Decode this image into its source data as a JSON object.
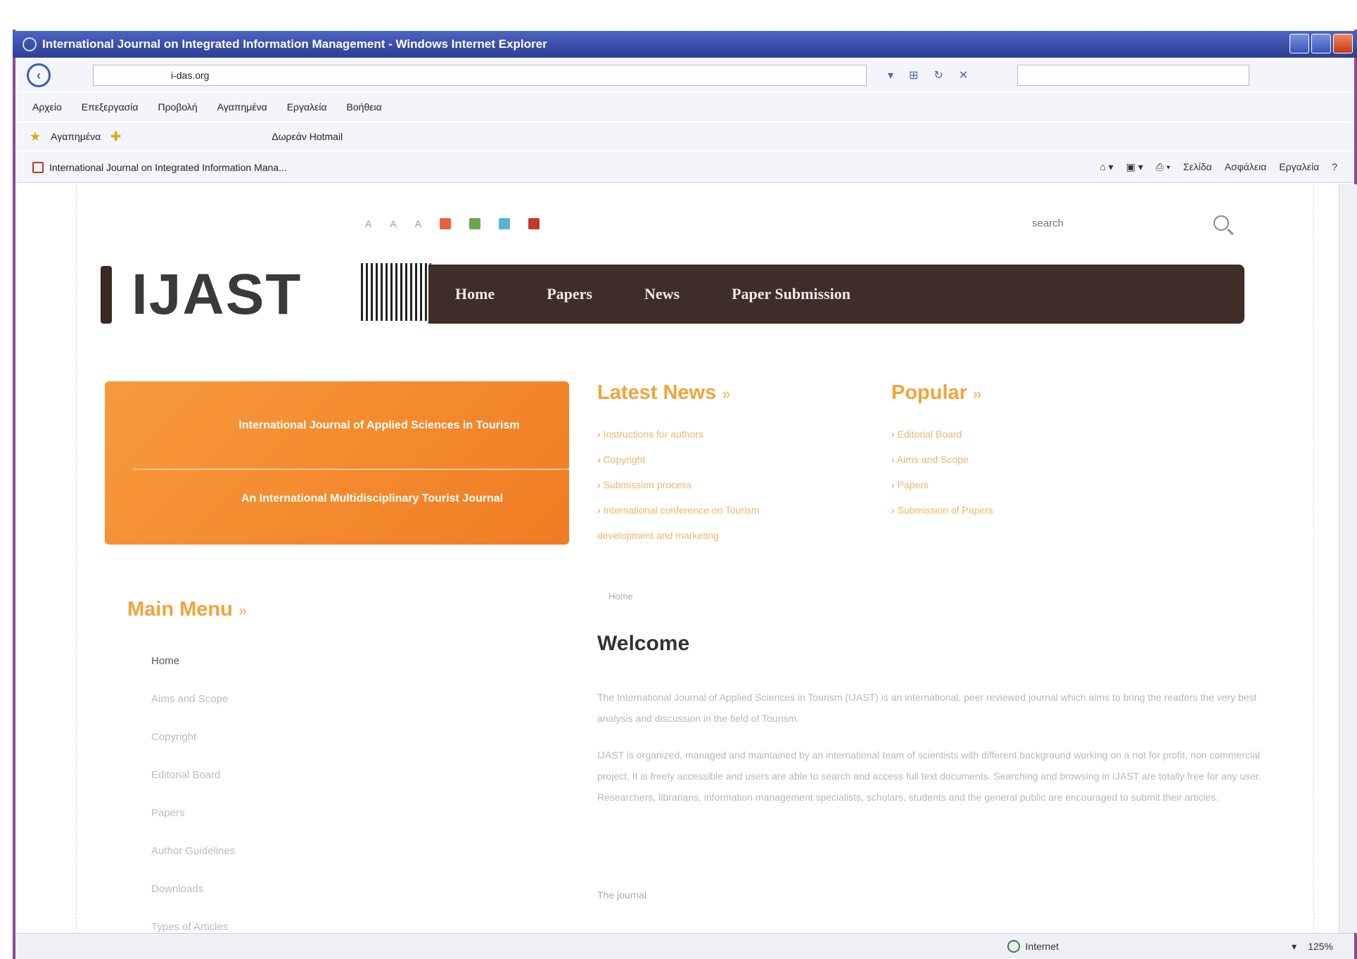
{
  "window": {
    "title": "International Journal on Integrated Information Management - Windows Internet Explorer"
  },
  "browser": {
    "address": "i-das.org",
    "menu": [
      "Αρχείο",
      "Επεξεργασία",
      "Προβολή",
      "Αγαπημένα",
      "Εργαλεία",
      "Βοήθεια"
    ],
    "favorites": {
      "label": "Αγαπημένα",
      "suggested": "Δωρεάν Hotmail"
    },
    "tab_title": "International Journal on Integrated Information Mana...",
    "command_bar": [
      "Σελίδα",
      "Ασφάλεια",
      "Εργαλεία"
    ],
    "status_zone": "Internet",
    "zoom": "125%"
  },
  "site": {
    "font_sizer": [
      "A",
      "A",
      "A"
    ],
    "theme_colors": [
      "#e8623a",
      "#6aa84f",
      "#5ab0d8",
      "#c0392b"
    ],
    "search_placeholder": "search",
    "logo": "IJAST",
    "nav": [
      "Home",
      "Papers",
      "News",
      "Paper Submission"
    ],
    "banner": {
      "line1": "International Journal of Applied Sciences in Tourism",
      "line2": "An International Multidisciplinary Tourist Journal"
    },
    "latest_news": {
      "title": "Latest News",
      "items": [
        "Instructions for authors",
        "Copyright",
        "Submission process",
        "International conference on Tourism",
        "development and marketing"
      ]
    },
    "popular": {
      "title": "Popular",
      "items": [
        "Editorial Board",
        "Aims and Scope",
        "Papers",
        "Submission of Papers"
      ]
    },
    "main_menu": {
      "title": "Main Menu",
      "items": [
        "Home",
        "Aims and Scope",
        "Copyright",
        "Editorial Board",
        "Papers",
        "Author Guidelines",
        "Downloads",
        "Types of Articles"
      ]
    },
    "breadcrumb": "Home",
    "welcome": {
      "title": "Welcome",
      "p1": "The International Journal of Applied Sciences in Tourism (IJAST) is an international, peer reviewed journal which aims to bring the readers the very best analysis and discussion in the field of Tourism.",
      "p2": "IJAST is organized, managed and maintained by an international team of scientists with different background working on a not for profit, non commercial project. It is freely accessible and users are able to search and access full text documents. Searching and browsing in IJAST are totally free for any user. Researchers, librarians, information management specialists, scholars, students and the general public are encouraged to submit their articles.",
      "journal_label": "The journal"
    }
  }
}
